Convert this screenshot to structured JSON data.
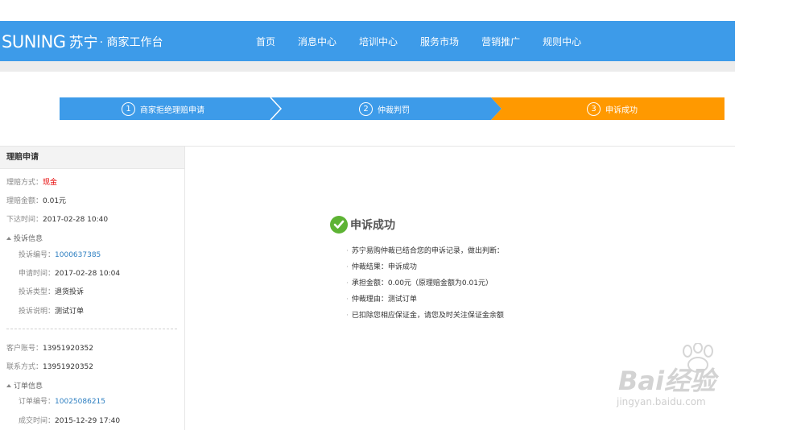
{
  "header": {
    "logo_brand": "SUNING",
    "logo_cn": "苏宁",
    "logo_sub": "· 商家工作台",
    "nav": [
      "首页",
      "消息中心",
      "培训中心",
      "服务市场",
      "营销推广",
      "规则中心"
    ]
  },
  "steps": [
    {
      "num": "1",
      "label": "商家拒绝理赔申请"
    },
    {
      "num": "2",
      "label": "仲裁判罚"
    },
    {
      "num": "3",
      "label": "申诉成功"
    }
  ],
  "colors": {
    "header_blue": "#3d9be9",
    "step_blue": "#3d9be9",
    "step_orange": "#ff9900",
    "success_green": "#5db334",
    "link_blue": "#2d7fc1",
    "red": "#e60000"
  },
  "sidebar": {
    "title": "理赔申请",
    "method_label": "理赔方式：",
    "method_value": "现金",
    "amount_label": "理赔金额：",
    "amount_value": "0.01元",
    "issue_time_label": "下达时间：",
    "issue_time_value": "2017-02-28 10:40",
    "complaint_group": "投诉信息",
    "complaint_no_label": "投诉编号：",
    "complaint_no_value": "1000637385",
    "apply_time_label": "申请时间：",
    "apply_time_value": "2017-02-28 10:04",
    "complaint_type_label": "投诉类型：",
    "complaint_type_value": "退货投诉",
    "complaint_desc_label": "投诉说明：",
    "complaint_desc_value": "测试订单",
    "customer_label": "客户账号：",
    "customer_value": "13951920352",
    "contact_label": "联系方式：",
    "contact_value": "13951920352",
    "order_group": "订单信息",
    "order_no_label": "订单编号：",
    "order_no_value": "10025086215",
    "deal_time_label": "成交时间：",
    "deal_time_value": "2015-12-29 17:40"
  },
  "result": {
    "title": "申诉成功",
    "lines": [
      "苏宁易购仲裁已结合您的申诉记录，做出判断：",
      "仲裁结果：申诉成功",
      "承担金额：0.00元（原理赔金额为0.01元）",
      "仲裁理由：测试订单",
      "已扣除您相应保证金，请您及时关注保证金余额"
    ]
  },
  "watermark": {
    "brand": "Bai经验",
    "sub": "jingyan.baidu.com"
  }
}
